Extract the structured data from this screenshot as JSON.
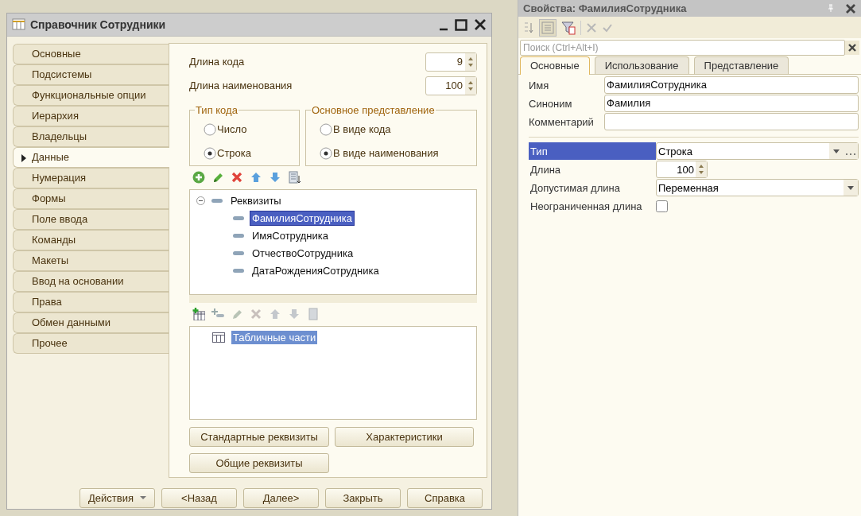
{
  "window": {
    "title": "Справочник Сотрудники"
  },
  "sidebar": {
    "items": [
      {
        "label": "Основные",
        "selected": false
      },
      {
        "label": "Подсистемы",
        "selected": false
      },
      {
        "label": "Функциональные опции",
        "selected": false
      },
      {
        "label": "Иерархия",
        "selected": false
      },
      {
        "label": "Владельцы",
        "selected": false
      },
      {
        "label": "Данные",
        "selected": true
      },
      {
        "label": "Нумерация",
        "selected": false
      },
      {
        "label": "Формы",
        "selected": false
      },
      {
        "label": "Поле ввода",
        "selected": false
      },
      {
        "label": "Команды",
        "selected": false
      },
      {
        "label": "Макеты",
        "selected": false
      },
      {
        "label": "Ввод на основании",
        "selected": false
      },
      {
        "label": "Права",
        "selected": false
      },
      {
        "label": "Обмен данными",
        "selected": false
      },
      {
        "label": "Прочее",
        "selected": false
      }
    ]
  },
  "data_tab": {
    "code_length": {
      "label": "Длина кода",
      "value": "9"
    },
    "name_length": {
      "label": "Длина наименования",
      "value": "100"
    },
    "code_type": {
      "title": "Тип кода",
      "options": [
        {
          "label": "Число",
          "selected": false
        },
        {
          "label": "Строка",
          "selected": true
        }
      ]
    },
    "main_presentation": {
      "title": "Основное представление",
      "options": [
        {
          "label": "В виде кода",
          "selected": false
        },
        {
          "label": "В виде наименования",
          "selected": true
        }
      ]
    },
    "attributes_tree": {
      "label": "Реквизиты",
      "expanded": true,
      "children": [
        {
          "label": "ФамилияСотрудника",
          "selected": true
        },
        {
          "label": "ИмяСотрудника",
          "selected": false
        },
        {
          "label": "ОтчествоСотрудника",
          "selected": false
        },
        {
          "label": "ДатаРожденияСотрудника",
          "selected": false
        }
      ]
    },
    "tabular_parts": [
      {
        "label": "Табличные части",
        "selected": true
      }
    ],
    "buttons": [
      "Стандартные реквизиты",
      "Характеристики",
      "Общие реквизиты"
    ]
  },
  "footer_buttons": [
    {
      "label": "Действия",
      "kind": "dropdown"
    },
    {
      "label": "<Назад",
      "kind": "plain"
    },
    {
      "label": "Далее>",
      "kind": "plain"
    },
    {
      "label": "Закрыть",
      "kind": "plain"
    },
    {
      "label": "Справка",
      "kind": "plain"
    }
  ],
  "properties": {
    "title": "Свойства: ФамилияСотрудника",
    "search": {
      "placeholder": "Поиск (Ctrl+Alt+I)"
    },
    "tabs": [
      {
        "label": "Основные",
        "selected": true
      },
      {
        "label": "Использование",
        "selected": false
      },
      {
        "label": "Представление",
        "selected": false
      }
    ],
    "fields": [
      {
        "label": "Имя",
        "value": "ФамилияСотрудника"
      },
      {
        "label": "Синоним",
        "value": "Фамилия"
      },
      {
        "label": "Комментарий"
      }
    ],
    "type_fields": [
      {
        "label": "Тип",
        "kind": "type",
        "value": "Строка",
        "selected": true
      },
      {
        "label": "Длина",
        "kind": "spin",
        "value": "100",
        "selected": false
      },
      {
        "label": "Допустимая длина",
        "kind": "select",
        "value": "Переменная",
        "selected": false
      },
      {
        "label": "Неограниченная длина",
        "kind": "checkbox",
        "checked": false,
        "selected": false
      }
    ]
  }
}
